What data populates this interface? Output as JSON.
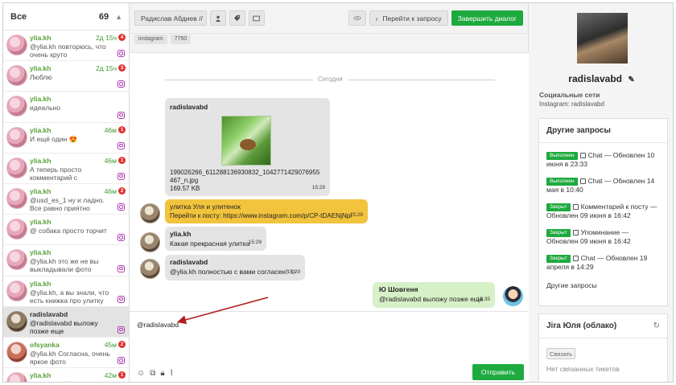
{
  "sidebar": {
    "title": "Все",
    "count": "69",
    "conversations": [
      {
        "name": "ylia.kh",
        "time": "2д 15ч",
        "badge": "4",
        "message": "@ylia.kh повторюсь, что очень круто"
      },
      {
        "name": "ylia.kh",
        "time": "2д 15ч",
        "badge": "3",
        "message": "Люблю"
      },
      {
        "name": "ylia.kh",
        "time": "",
        "badge": "",
        "message": "идеально"
      },
      {
        "name": "ylia.kh",
        "time": "46м",
        "badge": "1",
        "message": "И ещё один 😍"
      },
      {
        "name": "ylia.kh",
        "time": "46м",
        "badge": "1",
        "message": "А теперь просто комментарий с огонёчкам..."
      },
      {
        "name": "ylia.kh",
        "time": "46м",
        "badge": "2",
        "message": "@usd_es_1 ну и ладно. Все равно приятно"
      },
      {
        "name": "ylia.kh",
        "time": "",
        "badge": "",
        "message": "@ собака просто торчит"
      },
      {
        "name": "ylia.kh",
        "time": "",
        "badge": "",
        "message": "@ylia.kh это же не вы выкладывали фото"
      },
      {
        "name": "ylia.kh",
        "time": "",
        "badge": "",
        "message": "@ylia.kh, а вы знали, что есть книжка про улитку Улю=)"
      },
      {
        "name": "radislavabd",
        "time": "",
        "badge": "",
        "message": "@radislavabd выложу позже еще"
      },
      {
        "name": "ofsyanka",
        "time": "45м",
        "badge": "2",
        "message": "@ylia.kh Согласна, очень яркое фото"
      },
      {
        "name": "ylia.kh",
        "time": "42м",
        "badge": "1",
        "message": "Комментарий к посту"
      }
    ]
  },
  "toolbar": {
    "operator": "Радислав Абдиев //",
    "goto_label": "Перейти к запросу",
    "finish_label": "Завершить диалог",
    "tags": [
      "instagram",
      "7750"
    ]
  },
  "chat": {
    "date_label": "Сегодня",
    "messages": {
      "m1": {
        "author": "radislavabd",
        "file": "199026266_611288136930832_1042771429076955467_n.jpg",
        "size": "169.57 KB",
        "time": "15:29"
      },
      "m2": {
        "author": "улитка Уля и улитенок",
        "text": "Перейти к посту: https://www.instagram.com/p/CP-tDAENjNp/",
        "time": "15:29"
      },
      "m3": {
        "author": "ylia.kh",
        "text": "Какая прекрасная улитка",
        "time": "15:29"
      },
      "m4": {
        "author": "radislavabd",
        "text": "@ylia.kh полностью с вами согласен! ☺",
        "time": "15:29"
      },
      "m5": {
        "author": "Ю Шовгеня",
        "text": "@radislavabd выложу позже еще",
        "time": "15:35"
      }
    }
  },
  "compose": {
    "value": "@radislavabd",
    "send_label": "Отправить"
  },
  "profile": {
    "name": "radislavabd",
    "social_label": "Социальные сети",
    "instagram_line": "Instagram: radislavabd"
  },
  "requests": {
    "title": "Другие запросы",
    "items": [
      {
        "status": "Выполнен",
        "text": "Chat — Обновлен 10 июня в 23:33"
      },
      {
        "status": "Выполнен",
        "text": "Chat — Обновлен 14 мая в 10:40"
      },
      {
        "status": "Закрыт",
        "text": "Комментарий к посту — Обновлен 09 июня в 16:42"
      },
      {
        "status": "Закрыт",
        "text": "Упоминание — Обновлен 09 июня в 16:42"
      },
      {
        "status": "Закрыт",
        "text": "Chat — Обновлен 19 апреля в 14:29"
      }
    ],
    "more_label": "Другие запросы"
  },
  "jira": {
    "title": "Jira Юля (облако)",
    "link_label": "Связать",
    "empty_label": "Нет связанных тикетов"
  },
  "colors": {
    "accent_green": "#1eaa3e",
    "badge_red": "#e03030",
    "yellow_bubble": "#f2c33d",
    "green_bubble": "#d6f0c8",
    "instagram": "#b13ab6"
  }
}
